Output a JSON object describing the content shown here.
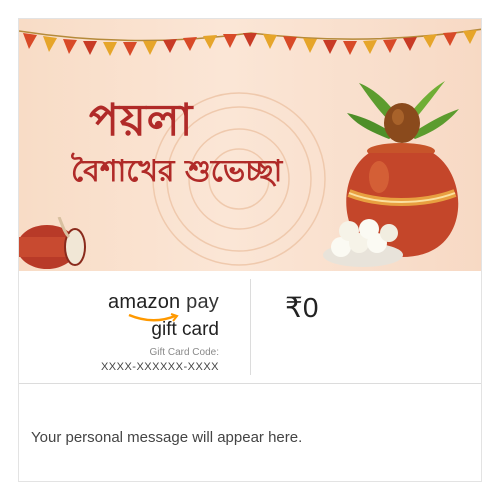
{
  "banner": {
    "title_line1": "পয়লা",
    "title_line2": "বৈশাখের শুভেচ্ছা"
  },
  "giftcard": {
    "brand_amazon": "amazon",
    "brand_pay": "pay",
    "type": "gift card",
    "code_label": "Gift Card Code:",
    "code_value": "XXXX-XXXXXX-XXXX",
    "amount": "₹0"
  },
  "message": {
    "placeholder": "Your personal message will appear here."
  },
  "colors": {
    "title": "#b02a28",
    "banner_bg": "#f8dcc6",
    "smile": "#ff9900"
  },
  "icons": [
    "bunting-decoration",
    "mandala-decoration",
    "kalash-pot-icon",
    "rasgulla-plate-icon",
    "dhak-drum-icon",
    "amazon-smile-logo"
  ]
}
